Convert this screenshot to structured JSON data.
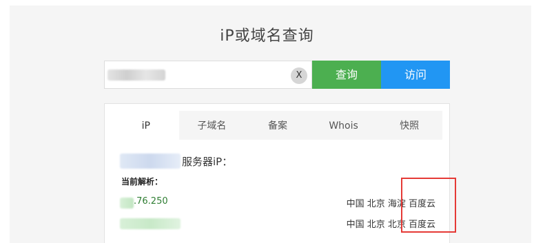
{
  "page": {
    "title": "iP或域名查询"
  },
  "search": {
    "value": "",
    "clear_label": "X",
    "query_label": "查询",
    "visit_label": "访问"
  },
  "tabs": [
    {
      "label": "iP"
    },
    {
      "label": "子域名"
    },
    {
      "label": "备案"
    },
    {
      "label": "Whois"
    },
    {
      "label": "快照"
    }
  ],
  "result": {
    "server_label": "服务器iP：",
    "current_label": "当前解析：",
    "records": [
      {
        "ip": ".76.250",
        "location": "中国 北京 海淀 百度云"
      },
      {
        "ip": "",
        "location": "中国 北京 北京 百度云"
      }
    ]
  },
  "colors": {
    "query_button": "#4caf50",
    "visit_button": "#2196f3",
    "highlight": "#e53935"
  }
}
